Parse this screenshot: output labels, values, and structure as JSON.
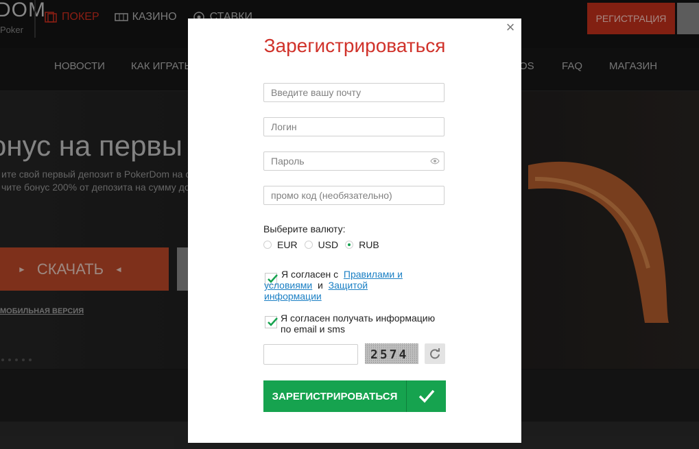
{
  "site": {
    "logo": "DOM",
    "logo_sub": "Poker",
    "top_nav": [
      {
        "label": "ПОКЕР",
        "icon": "card-icon",
        "active": true
      },
      {
        "label": "КАЗИНО",
        "icon": "slot-icon",
        "active": false
      },
      {
        "label": "СТАВКИ",
        "icon": "ball-icon",
        "active": false
      }
    ],
    "register_button": "РЕГИСТРАЦИЯ",
    "menu": [
      "НОВОСТИ",
      "КАК ИГРАТЬ",
      "OS",
      "FAQ",
      "МАГАЗИН"
    ],
    "hero": {
      "title": "онус на первы",
      "line1": "ите свой первый депозит в PokerDom на с",
      "line2": "чите бонус 200% от депозита на сумму до",
      "download": "СКАЧАТЬ",
      "mobile_link": "МОБИЛЬНАЯ ВЕРСИЯ"
    },
    "accent_color": "#c8321d"
  },
  "modal": {
    "title": "Зарегистрироваться",
    "email_placeholder": "Введите вашу почту",
    "login_placeholder": "Логин",
    "password_placeholder": "Пароль",
    "promo_placeholder": "промо код (необязательно)",
    "currency_label": "Выберите валюту:",
    "currencies": [
      {
        "label": "EUR",
        "selected": false
      },
      {
        "label": "USD",
        "selected": false
      },
      {
        "label": "RUB",
        "selected": true
      }
    ],
    "agree_prefix": "Я согласен с",
    "rules_link": "Правилами и условиями",
    "agree_and": "и",
    "privacy_link": "Защитой информации",
    "agree_rules_checked": true,
    "newsletter_text": "Я согласен получать информацию по email и sms",
    "newsletter_checked": true,
    "captcha_value": "",
    "captcha_text": "2574",
    "submit_label": "ЗАРЕГИСТРИРОВАТЬСЯ",
    "title_color": "#d0322a",
    "submit_color": "#16a34f"
  }
}
